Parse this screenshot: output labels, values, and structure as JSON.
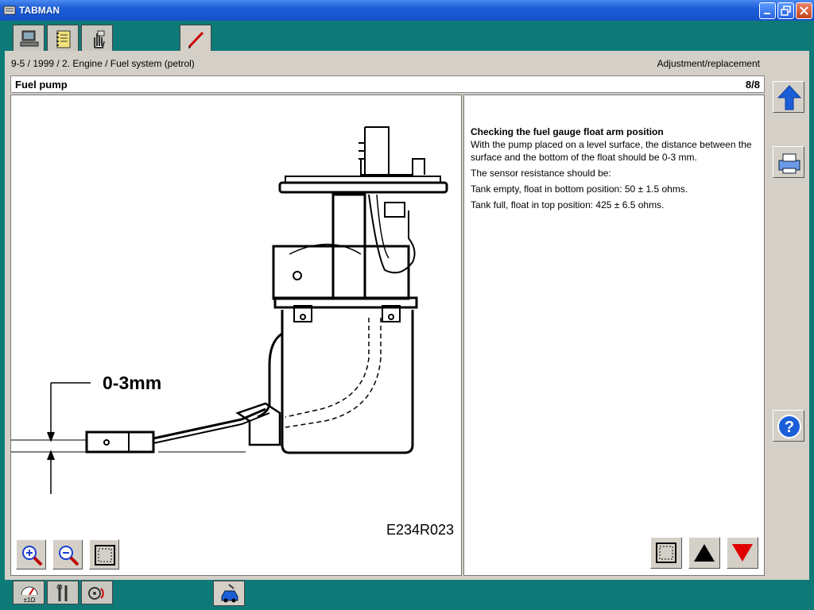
{
  "window": {
    "title": "TABMAN"
  },
  "breadcrumb": "9-5 / 1999 / 2. Engine / Fuel system (petrol)",
  "section_type": "Adjustment/replacement",
  "page": {
    "title": "Fuel pump",
    "number": "8/8"
  },
  "figure": {
    "dimension_label": "0-3mm",
    "code": "E234R023"
  },
  "text": {
    "heading": "Checking the fuel gauge float arm position",
    "para1": "With the pump placed on a level surface, the distance between the surface and the bottom of the float should be 0-3 mm.",
    "para2": "The sensor resistance should be:",
    "para3": "Tank empty, float in bottom position: 50 ± 1.5 ohms.",
    "para4": "Tank full, float in top position: 425 ± 6.5 ohms."
  },
  "colors": {
    "accent": "#1a5fd8",
    "background": "#0e7a78",
    "nav_down": "#e00000"
  },
  "icons": [
    "computer-icon",
    "notebook-icon",
    "hand-icon",
    "pen-icon",
    "arrow-up-icon",
    "printer-icon",
    "help-icon",
    "zoom-in-icon",
    "zoom-out-icon",
    "fit-icon",
    "gauge-icon",
    "wrench-icon",
    "diagnosis-icon",
    "car-icon"
  ]
}
